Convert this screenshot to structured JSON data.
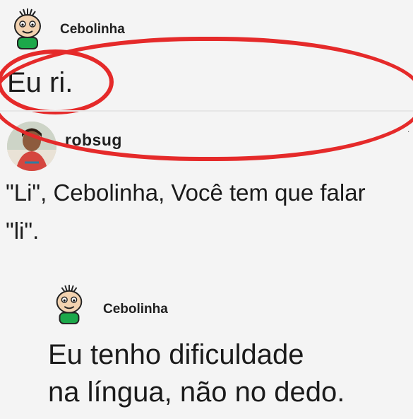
{
  "posts": [
    {
      "username": "Cebolinha",
      "message": [
        "Eu ri."
      ],
      "avatar": "cebolinha-avatar-icon"
    },
    {
      "username": "robsug",
      "message": [
        "\"Li\", Cebolinha, Você tem que falar",
        "\"li\"."
      ],
      "avatar": "robsug-avatar-photo"
    },
    {
      "username": "Cebolinha",
      "message": [
        "Eu tenho dificuldade",
        "na língua, não no dedo."
      ],
      "avatar": "cebolinha-avatar-icon"
    }
  ],
  "colors": {
    "highlight_circle": "#e52a2a",
    "background": "#f4f4f4",
    "text": "#1b1b1b"
  }
}
